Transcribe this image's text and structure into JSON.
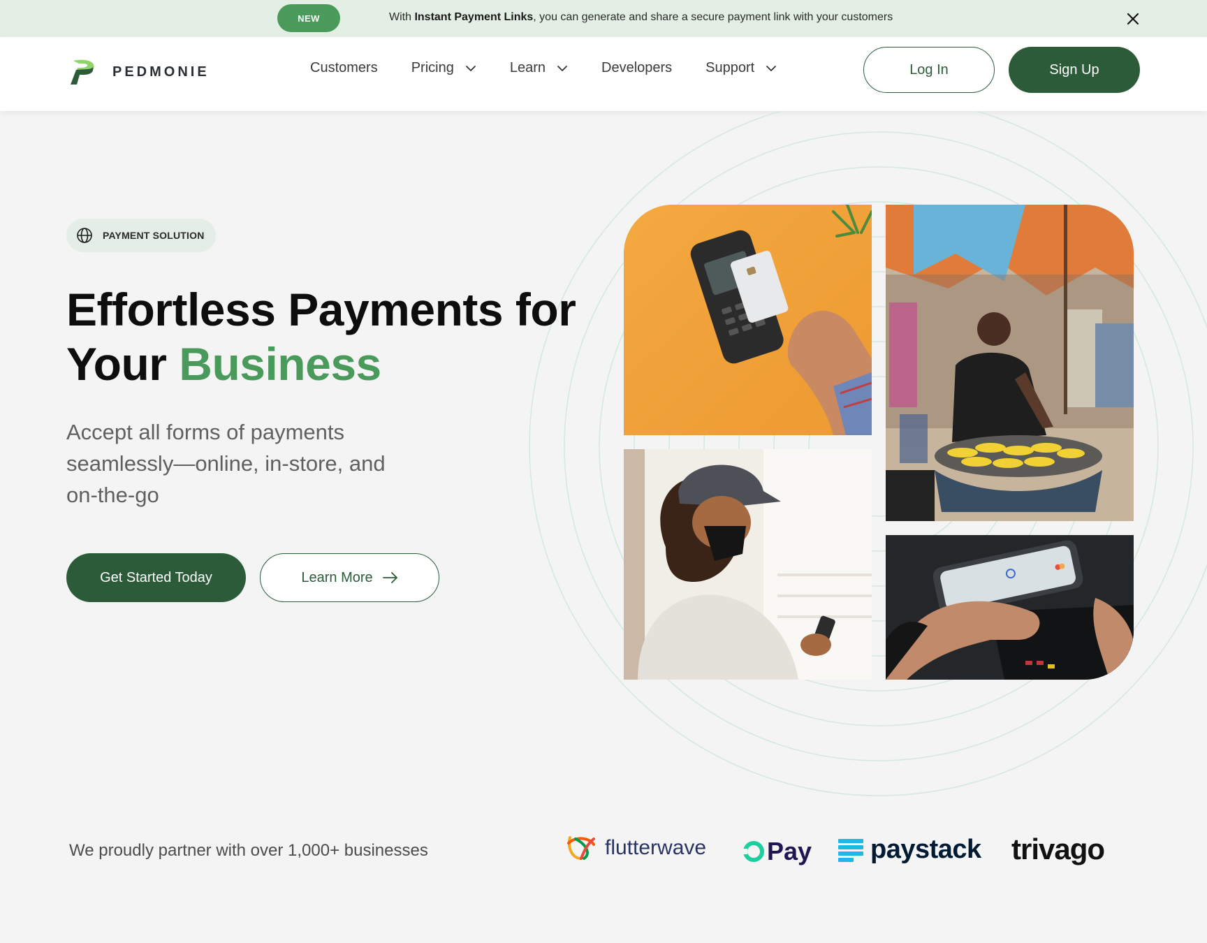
{
  "announcement": {
    "badge": "NEW",
    "prefix": "With ",
    "highlight": "Instant Payment Links",
    "suffix": ", you can generate and share a secure payment link with your customers",
    "close_icon": "close-icon"
  },
  "header": {
    "brand": "PEDMONIE",
    "nav": [
      {
        "label": "Customers",
        "has_dropdown": false
      },
      {
        "label": "Pricing",
        "has_dropdown": true
      },
      {
        "label": "Learn",
        "has_dropdown": true
      },
      {
        "label": "Developers",
        "has_dropdown": false
      },
      {
        "label": "Support",
        "has_dropdown": true
      }
    ],
    "login_label": "Log In",
    "signup_label": "Sign Up"
  },
  "hero": {
    "tag": "PAYMENT SOLUTION",
    "tag_icon": "globe-icon",
    "headline_line1": "Effortless Payments for",
    "headline_line2_prefix": "Your ",
    "headline_accent": "Business",
    "subheading": "Accept all forms of payments seamlessly—online, in-store, and on-the-go",
    "primary_cta": "Get Started Today",
    "secondary_cta": "Learn More",
    "secondary_cta_icon": "arrow-right-icon"
  },
  "partners": {
    "text": "We proudly partner with over 1,000+ businesses",
    "logos": [
      "flutterwave",
      "Pay",
      "paystack",
      "trivago"
    ]
  },
  "colors": {
    "brand_green": "#2c5b3a",
    "accent_green": "#4a9a5c",
    "announcement_bg": "#e3efe4",
    "page_bg": "#f3f4f3"
  }
}
